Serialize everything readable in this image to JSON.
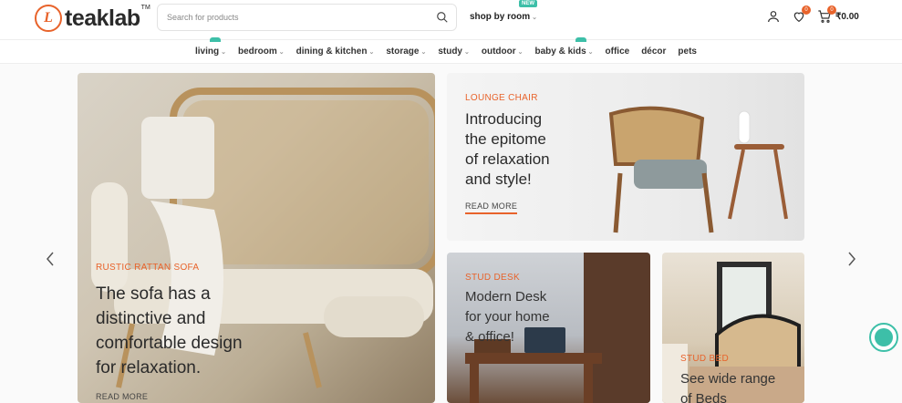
{
  "brand": {
    "name": "teaklab",
    "mark": "L",
    "tm": "TM"
  },
  "search": {
    "placeholder": "Search for products"
  },
  "header": {
    "shop_by_room": "shop by room",
    "new_badge": "NEW",
    "wishlist_count": "0",
    "cart_count": "0",
    "cart_total": "₹0.00"
  },
  "nav": {
    "items": [
      {
        "label": "living"
      },
      {
        "label": "bedroom"
      },
      {
        "label": "dining & kitchen"
      },
      {
        "label": "storage"
      },
      {
        "label": "study"
      },
      {
        "label": "outdoor"
      },
      {
        "label": "baby & kids"
      },
      {
        "label": "office"
      },
      {
        "label": "décor"
      },
      {
        "label": "pets"
      }
    ]
  },
  "banners": {
    "main": {
      "category": "RUSTIC RATTAN SOFA",
      "title_lines": [
        "The sofa has a",
        "distinctive and",
        "comfortable design",
        "for relaxation."
      ],
      "cta": "READ MORE"
    },
    "lounge": {
      "category": "LOUNGE CHAIR",
      "title_lines": [
        "Introducing",
        "the epitome",
        "of relaxation",
        "and style!"
      ],
      "cta": "READ MORE"
    },
    "desk": {
      "category": "STUD DESK",
      "title_lines": [
        "Modern Desk",
        "for your home",
        "& office!"
      ]
    },
    "bed": {
      "category": "STUD BED",
      "title_lines": [
        "See wide range",
        "of Beds"
      ]
    }
  },
  "colors": {
    "accent": "#e8632b",
    "teal": "#3dbfa8"
  }
}
